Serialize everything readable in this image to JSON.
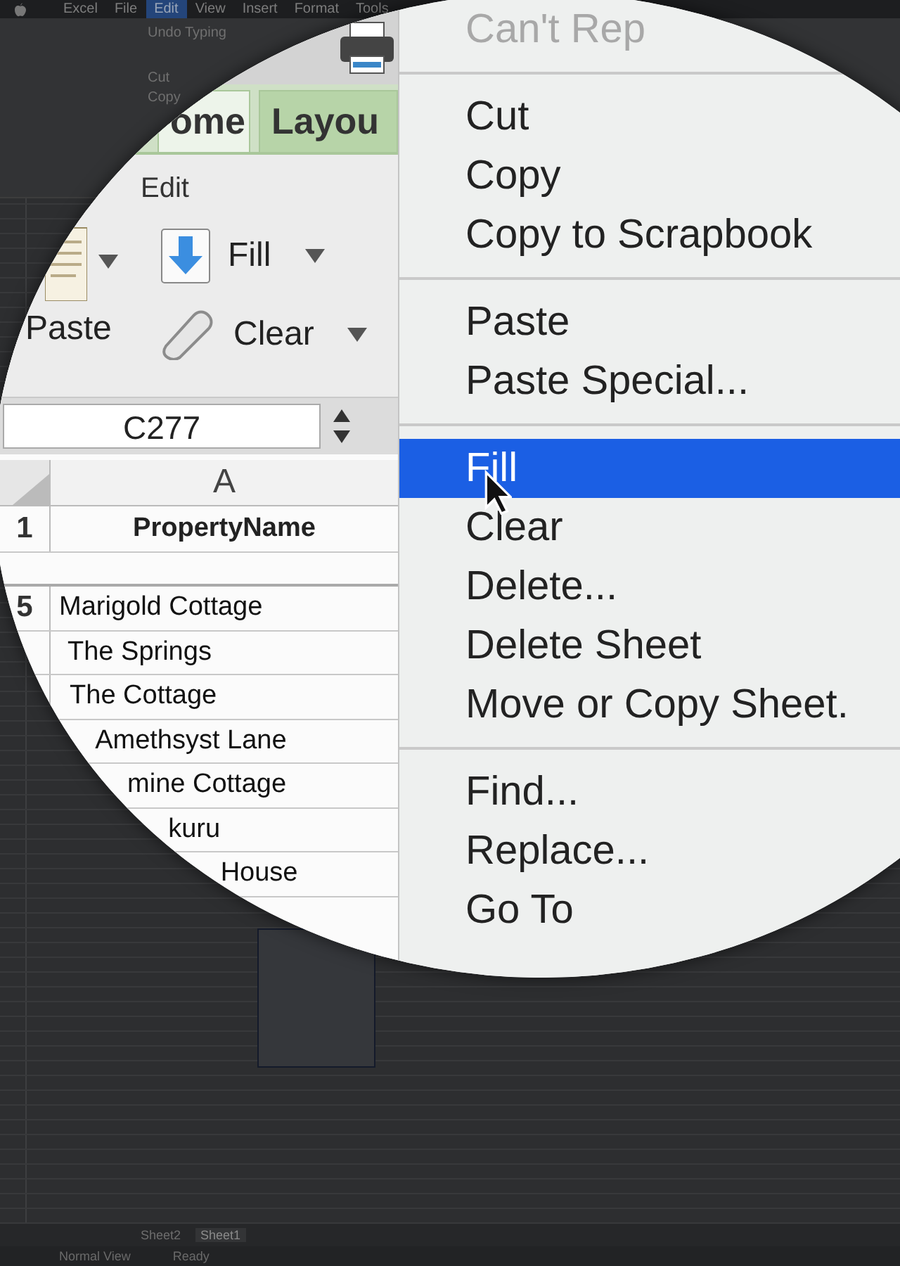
{
  "menu_bar": [
    {
      "label": "Excel",
      "selected": false
    },
    {
      "label": "File",
      "selected": false
    },
    {
      "label": "Edit",
      "selected": true
    },
    {
      "label": "View",
      "selected": false
    },
    {
      "label": "Insert",
      "selected": false
    },
    {
      "label": "Format",
      "selected": false
    },
    {
      "label": "Tools",
      "selected": false
    }
  ],
  "small_edit_menu": [
    "Undo Typing",
    "Cut",
    "Copy"
  ],
  "lens": {
    "ribbon_tabs": [
      {
        "label": "ome",
        "selected": true
      },
      {
        "label": "Layou",
        "selected": false
      }
    ],
    "ribbon_group": "Edit",
    "paste_button": "Paste",
    "fill_button": "Fill",
    "clear_button": "Clear",
    "name_box": "C277",
    "column_header": "A",
    "header_row": {
      "number": "1",
      "value": "PropertyName"
    },
    "rows": [
      {
        "number": "5",
        "value": "Marigold Cottage"
      },
      {
        "value": "The Springs"
      },
      {
        "value": "The Cottage"
      },
      {
        "value": "Amethsyst Lane"
      },
      {
        "value": "mine Cottage"
      },
      {
        "value": "kuru"
      },
      {
        "value": "House"
      }
    ],
    "context_menu": [
      {
        "kind": "item",
        "label": "Can't Rep",
        "disabled": true,
        "selected": false
      },
      {
        "kind": "separator"
      },
      {
        "kind": "item",
        "label": "Cut",
        "disabled": false,
        "selected": false
      },
      {
        "kind": "item",
        "label": "Copy",
        "disabled": false,
        "selected": false
      },
      {
        "kind": "item",
        "label": "Copy to Scrapbook",
        "disabled": false,
        "selected": false
      },
      {
        "kind": "separator"
      },
      {
        "kind": "item",
        "label": "Paste",
        "disabled": false,
        "selected": false
      },
      {
        "kind": "item",
        "label": "Paste Special...",
        "disabled": false,
        "selected": false
      },
      {
        "kind": "separator"
      },
      {
        "kind": "item",
        "label": "Fill",
        "disabled": false,
        "selected": true
      },
      {
        "kind": "item",
        "label": "Clear",
        "disabled": false,
        "selected": false
      },
      {
        "kind": "item",
        "label": "Delete...",
        "disabled": false,
        "selected": false
      },
      {
        "kind": "item",
        "label": "Delete Sheet",
        "disabled": false,
        "selected": false
      },
      {
        "kind": "item",
        "label": "Move or Copy Sheet.",
        "disabled": false,
        "selected": false
      },
      {
        "kind": "separator"
      },
      {
        "kind": "item",
        "label": "Find...",
        "disabled": false,
        "selected": false
      },
      {
        "kind": "item",
        "label": "Replace...",
        "disabled": false,
        "selected": false
      },
      {
        "kind": "item",
        "label": "Go To",
        "disabled": false,
        "selected": false
      }
    ]
  },
  "sheet_tabs": [
    {
      "label": "Sheet2",
      "selected": false
    },
    {
      "label": "Sheet1",
      "selected": true
    }
  ],
  "status_bar": [
    "Normal View",
    "Ready"
  ]
}
